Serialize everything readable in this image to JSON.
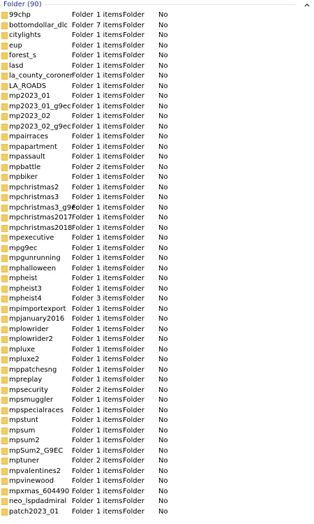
{
  "group": {
    "title": "Folder (90)",
    "chevron_icon": "chevron-up-icon"
  },
  "colors": {
    "group_title": "#1e3287",
    "folder_icon": "#f6ca5e"
  },
  "rows": [
    {
      "name": "99chp",
      "type": "Folder",
      "size": "1 items",
      "kind": "Folder",
      "flag": "No"
    },
    {
      "name": "bottomdollar_dlc",
      "type": "Folder",
      "size": "7 items",
      "kind": "Folder",
      "flag": "No"
    },
    {
      "name": "citylights",
      "type": "Folder",
      "size": "1 items",
      "kind": "Folder",
      "flag": "No"
    },
    {
      "name": "eup",
      "type": "Folder",
      "size": "1 items",
      "kind": "Folder",
      "flag": "No"
    },
    {
      "name": "forest_s",
      "type": "Folder",
      "size": "1 items",
      "kind": "Folder",
      "flag": "No"
    },
    {
      "name": "lasd",
      "type": "Folder",
      "size": "1 items",
      "kind": "Folder",
      "flag": "No"
    },
    {
      "name": "la_county_coroner",
      "type": "Folder",
      "size": "1 items",
      "kind": "Folder",
      "flag": "No"
    },
    {
      "name": "LA_ROADS",
      "type": "Folder",
      "size": "1 items",
      "kind": "Folder",
      "flag": "No"
    },
    {
      "name": "mp2023_01",
      "type": "Folder",
      "size": "1 items",
      "kind": "Folder",
      "flag": "No"
    },
    {
      "name": "mp2023_01_g9ec",
      "type": "Folder",
      "size": "1 items",
      "kind": "Folder",
      "flag": "No"
    },
    {
      "name": "mp2023_02",
      "type": "Folder",
      "size": "1 items",
      "kind": "Folder",
      "flag": "No"
    },
    {
      "name": "mp2023_02_g9ec",
      "type": "Folder",
      "size": "1 items",
      "kind": "Folder",
      "flag": "No"
    },
    {
      "name": "mpairraces",
      "type": "Folder",
      "size": "1 items",
      "kind": "Folder",
      "flag": "No"
    },
    {
      "name": "mpapartment",
      "type": "Folder",
      "size": "1 items",
      "kind": "Folder",
      "flag": "No"
    },
    {
      "name": "mpassault",
      "type": "Folder",
      "size": "1 items",
      "kind": "Folder",
      "flag": "No"
    },
    {
      "name": "mpbattle",
      "type": "Folder",
      "size": "2 items",
      "kind": "Folder",
      "flag": "No"
    },
    {
      "name": "mpbiker",
      "type": "Folder",
      "size": "1 items",
      "kind": "Folder",
      "flag": "No"
    },
    {
      "name": "mpchristmas2",
      "type": "Folder",
      "size": "1 items",
      "kind": "Folder",
      "flag": "No"
    },
    {
      "name": "mpchristmas3",
      "type": "Folder",
      "size": "1 items",
      "kind": "Folder",
      "flag": "No"
    },
    {
      "name": "mpchristmas3_g9ec",
      "type": "Folder",
      "size": "1 items",
      "kind": "Folder",
      "flag": "No"
    },
    {
      "name": "mpchristmas2017",
      "type": "Folder",
      "size": "1 items",
      "kind": "Folder",
      "flag": "No"
    },
    {
      "name": "mpchristmas2018",
      "type": "Folder",
      "size": "1 items",
      "kind": "Folder",
      "flag": "No"
    },
    {
      "name": "mpexecutive",
      "type": "Folder",
      "size": "1 items",
      "kind": "Folder",
      "flag": "No"
    },
    {
      "name": "mpg9ec",
      "type": "Folder",
      "size": "1 items",
      "kind": "Folder",
      "flag": "No"
    },
    {
      "name": "mpgunrunning",
      "type": "Folder",
      "size": "1 items",
      "kind": "Folder",
      "flag": "No"
    },
    {
      "name": "mphalloween",
      "type": "Folder",
      "size": "1 items",
      "kind": "Folder",
      "flag": "No"
    },
    {
      "name": "mpheist",
      "type": "Folder",
      "size": "1 items",
      "kind": "Folder",
      "flag": "No"
    },
    {
      "name": "mpheist3",
      "type": "Folder",
      "size": "1 items",
      "kind": "Folder",
      "flag": "No"
    },
    {
      "name": "mpheist4",
      "type": "Folder",
      "size": "3 items",
      "kind": "Folder",
      "flag": "No"
    },
    {
      "name": "mpimportexport",
      "type": "Folder",
      "size": "1 items",
      "kind": "Folder",
      "flag": "No"
    },
    {
      "name": "mpjanuary2016",
      "type": "Folder",
      "size": "1 items",
      "kind": "Folder",
      "flag": "No"
    },
    {
      "name": "mplowrider",
      "type": "Folder",
      "size": "1 items",
      "kind": "Folder",
      "flag": "No"
    },
    {
      "name": "mplowrider2",
      "type": "Folder",
      "size": "1 items",
      "kind": "Folder",
      "flag": "No"
    },
    {
      "name": "mpluxe",
      "type": "Folder",
      "size": "1 items",
      "kind": "Folder",
      "flag": "No"
    },
    {
      "name": "mpluxe2",
      "type": "Folder",
      "size": "1 items",
      "kind": "Folder",
      "flag": "No"
    },
    {
      "name": "mppatchesng",
      "type": "Folder",
      "size": "1 items",
      "kind": "Folder",
      "flag": "No"
    },
    {
      "name": "mpreplay",
      "type": "Folder",
      "size": "1 items",
      "kind": "Folder",
      "flag": "No"
    },
    {
      "name": "mpsecurity",
      "type": "Folder",
      "size": "2 items",
      "kind": "Folder",
      "flag": "No"
    },
    {
      "name": "mpsmuggler",
      "type": "Folder",
      "size": "1 items",
      "kind": "Folder",
      "flag": "No"
    },
    {
      "name": "mpspecialraces",
      "type": "Folder",
      "size": "1 items",
      "kind": "Folder",
      "flag": "No"
    },
    {
      "name": "mpstunt",
      "type": "Folder",
      "size": "1 items",
      "kind": "Folder",
      "flag": "No"
    },
    {
      "name": "mpsum",
      "type": "Folder",
      "size": "1 items",
      "kind": "Folder",
      "flag": "No"
    },
    {
      "name": "mpsum2",
      "type": "Folder",
      "size": "1 items",
      "kind": "Folder",
      "flag": "No"
    },
    {
      "name": "mpSum2_G9EC",
      "type": "Folder",
      "size": "1 items",
      "kind": "Folder",
      "flag": "No"
    },
    {
      "name": "mptuner",
      "type": "Folder",
      "size": "2 items",
      "kind": "Folder",
      "flag": "No"
    },
    {
      "name": "mpvalentines2",
      "type": "Folder",
      "size": "1 items",
      "kind": "Folder",
      "flag": "No"
    },
    {
      "name": "mpvinewood",
      "type": "Folder",
      "size": "1 items",
      "kind": "Folder",
      "flag": "No"
    },
    {
      "name": "mpxmas_604490",
      "type": "Folder",
      "size": "1 items",
      "kind": "Folder",
      "flag": "No"
    },
    {
      "name": "neo_lspdadmiral",
      "type": "Folder",
      "size": "1 items",
      "kind": "Folder",
      "flag": "No"
    },
    {
      "name": "patch2023_01",
      "type": "Folder",
      "size": "1 items",
      "kind": "Folder",
      "flag": "No"
    }
  ]
}
